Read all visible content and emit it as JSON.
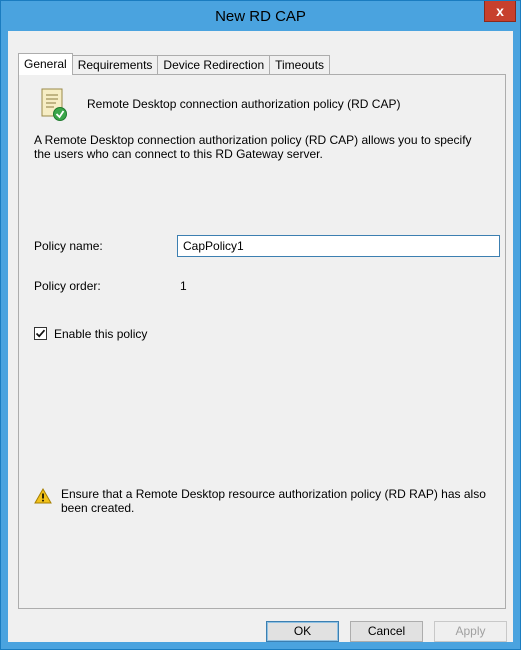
{
  "window": {
    "title": "New RD CAP",
    "close_label": "x"
  },
  "tabs": [
    {
      "label": "General",
      "active": true
    },
    {
      "label": "Requirements",
      "active": false
    },
    {
      "label": "Device Redirection",
      "active": false
    },
    {
      "label": "Timeouts",
      "active": false
    }
  ],
  "general": {
    "header_icon": "policy-document-check-icon",
    "header_title": "Remote Desktop connection authorization policy (RD CAP)",
    "description": "A Remote Desktop connection authorization policy (RD CAP) allows you to specify the users who can connect to this RD Gateway server.",
    "policy_name_label": "Policy name:",
    "policy_name_value": "CapPolicy1",
    "policy_order_label": "Policy order:",
    "policy_order_value": "1",
    "enable_label": "Enable this policy",
    "enable_checked": true,
    "warning_icon": "warning-icon",
    "warning_text": "Ensure that a Remote Desktop resource authorization policy (RD RAP) has also been created."
  },
  "buttons": {
    "ok": "OK",
    "cancel": "Cancel",
    "apply": "Apply"
  },
  "colors": {
    "titlebar": "#4aa3df",
    "close": "#c7402d",
    "dialog_bg": "#f0f0f0"
  }
}
